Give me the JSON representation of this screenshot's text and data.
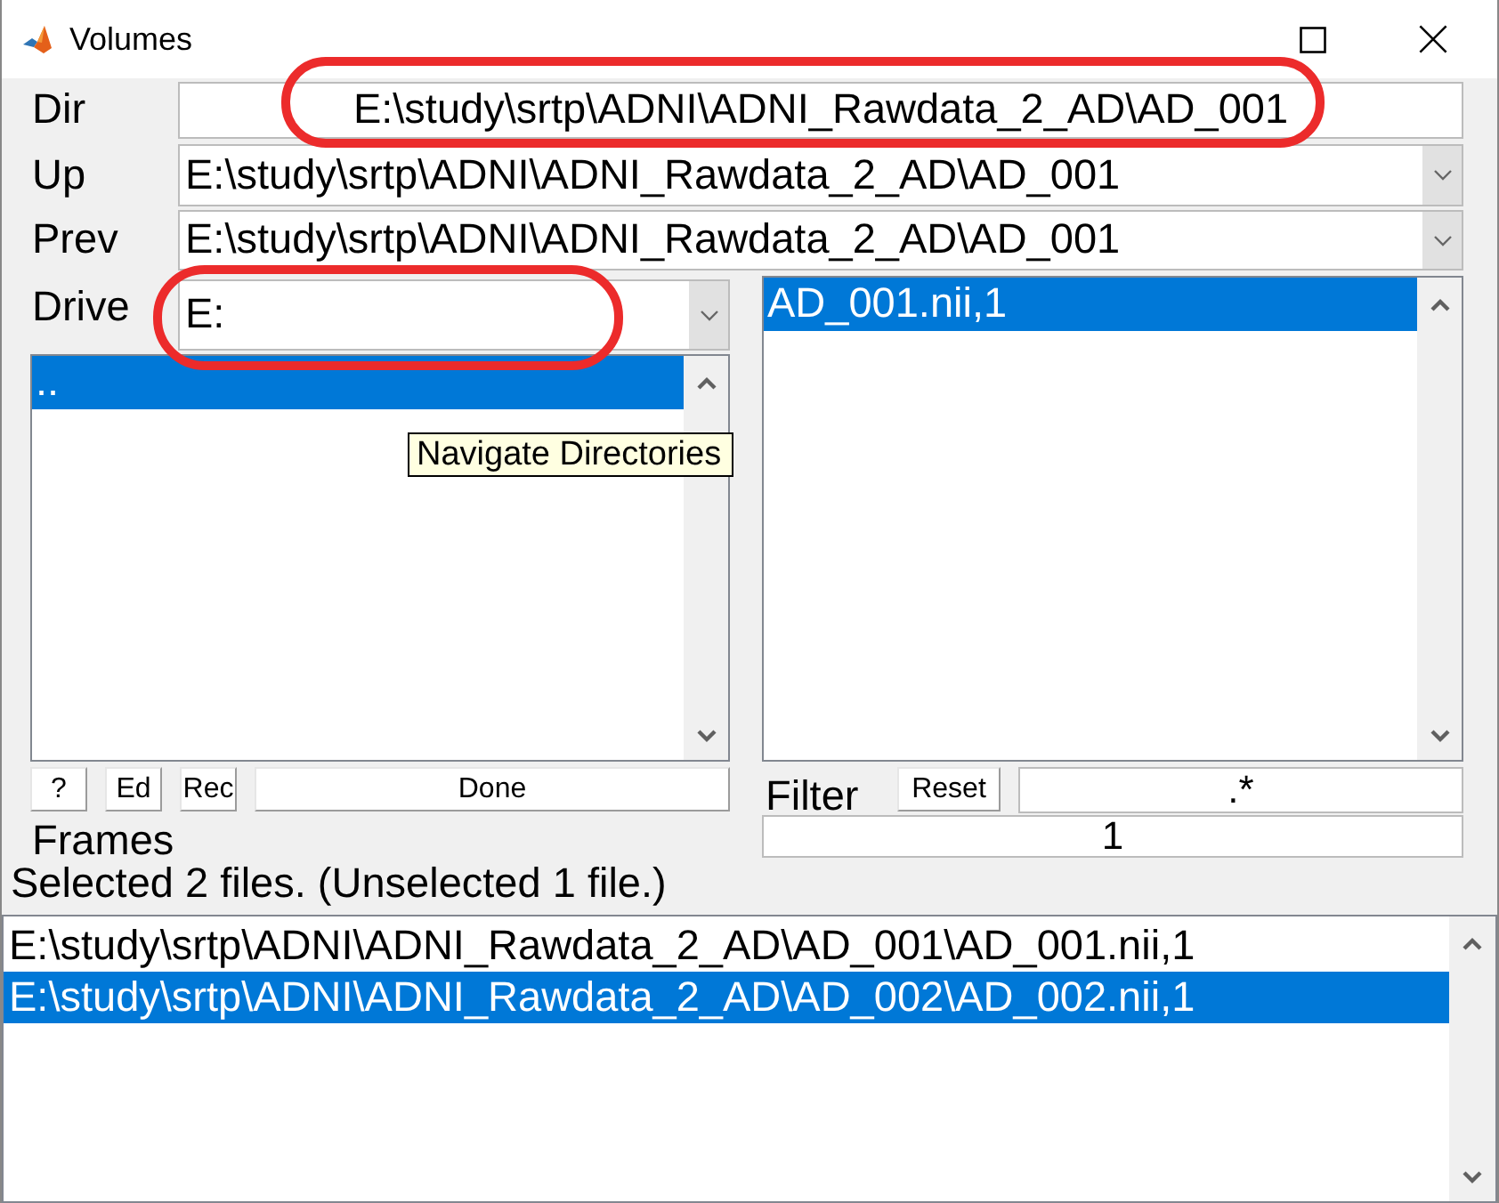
{
  "window": {
    "title": "Volumes"
  },
  "dir": {
    "label": "Dir",
    "value": "E:\\study\\srtp\\ADNI\\ADNI_Rawdata_2_AD\\AD_001",
    "circled": true
  },
  "up": {
    "label": "Up",
    "value": "E:\\study\\srtp\\ADNI\\ADNI_Rawdata_2_AD\\AD_001"
  },
  "prev": {
    "label": "Prev",
    "value": "E:\\study\\srtp\\ADNI\\ADNI_Rawdata_2_AD\\AD_001"
  },
  "drive": {
    "label": "Drive",
    "value": "E:",
    "circled": true
  },
  "directories": {
    "items": [
      {
        "text": "..",
        "selected": true
      }
    ],
    "tooltip": "Navigate Directories"
  },
  "files": {
    "items": [
      {
        "text": "AD_001.nii,1",
        "selected": true
      }
    ]
  },
  "buttons": [
    {
      "label": "?"
    },
    {
      "label": "Ed"
    },
    {
      "label": "Rec"
    },
    {
      "label": "Done"
    }
  ],
  "filter": {
    "label": "Filter",
    "reset": "Reset",
    "value": ".*"
  },
  "frames": {
    "label": "Frames",
    "value": "1"
  },
  "status": "Selected 2 files. (Unselected 1 file.)",
  "selected_files": [
    {
      "text": "E:\\study\\srtp\\ADNI\\ADNI_Rawdata_2_AD\\AD_001\\AD_001.nii,1",
      "selected": false
    },
    {
      "text": "E:\\study\\srtp\\ADNI\\ADNI_Rawdata_2_AD\\AD_002\\AD_002.nii,1",
      "selected": true
    }
  ]
}
